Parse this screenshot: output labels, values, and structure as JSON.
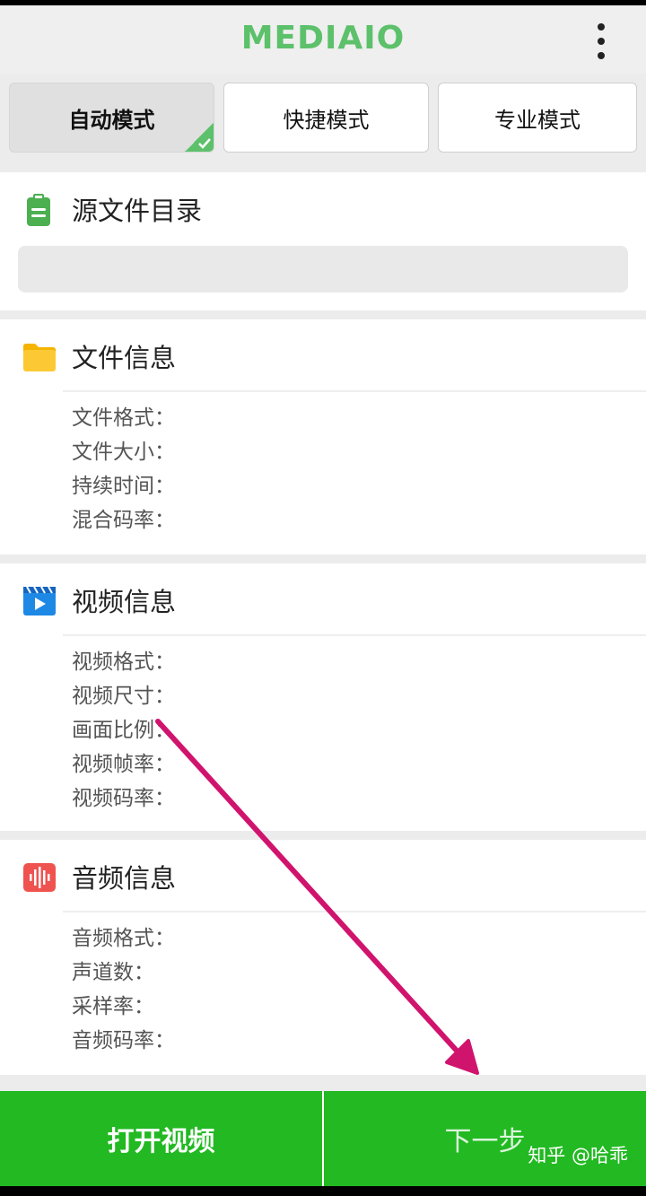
{
  "app": {
    "title": "MEDIAIO"
  },
  "tabs": [
    {
      "label": "自动模式",
      "active": true
    },
    {
      "label": "快捷模式",
      "active": false
    },
    {
      "label": "专业模式",
      "active": false
    }
  ],
  "source": {
    "title": "源文件目录",
    "path": ""
  },
  "file_info": {
    "title": "文件信息",
    "rows": [
      "文件格式：",
      "文件大小：",
      "持续时间：",
      "混合码率："
    ]
  },
  "video_info": {
    "title": "视频信息",
    "rows": [
      "视频格式：",
      "视频尺寸：",
      "画面比例：",
      "视频帧率：",
      "视频码率："
    ]
  },
  "audio_info": {
    "title": "音频信息",
    "rows": [
      "音频格式：",
      "声道数：",
      "采样率：",
      "音频码率："
    ]
  },
  "bottom": {
    "open_label": "打开视频",
    "next_label": "下一步"
  },
  "watermark": "知乎 @哈乖",
  "colors": {
    "brand_green": "#5cc16a",
    "button_green": "#22b922",
    "arrow_magenta": "#d0146e"
  },
  "icons": {
    "source": "clipboard-icon",
    "file": "folder-icon",
    "video": "video-play-icon",
    "audio": "audio-wave-icon",
    "menu": "more-vert-icon"
  }
}
